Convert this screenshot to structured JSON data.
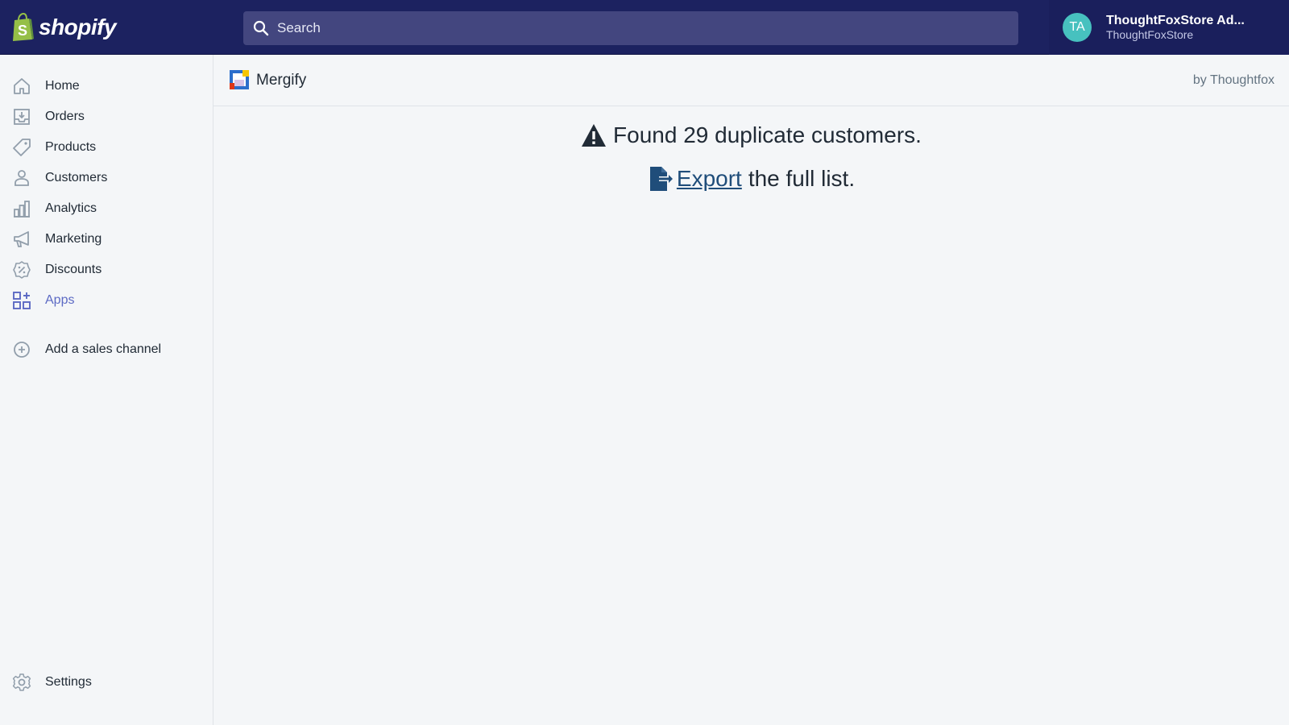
{
  "topbar": {
    "logo_text": "shopify",
    "search_placeholder": "Search",
    "user": {
      "initials": "TA",
      "name": "ThoughtFoxStore Ad...",
      "store": "ThoughtFoxStore"
    }
  },
  "sidebar": {
    "items": [
      {
        "label": "Home",
        "icon": "home-icon"
      },
      {
        "label": "Orders",
        "icon": "orders-icon"
      },
      {
        "label": "Products",
        "icon": "tag-icon"
      },
      {
        "label": "Customers",
        "icon": "person-icon"
      },
      {
        "label": "Analytics",
        "icon": "bar-chart-icon"
      },
      {
        "label": "Marketing",
        "icon": "megaphone-icon"
      },
      {
        "label": "Discounts",
        "icon": "discount-icon"
      },
      {
        "label": "Apps",
        "icon": "apps-icon",
        "active": true
      }
    ],
    "add_channel_label": "Add a sales channel",
    "settings_label": "Settings"
  },
  "app": {
    "name": "Mergify",
    "by": "by Thoughtfox"
  },
  "content": {
    "found_text": "Found 29 duplicate customers.",
    "export_link": "Export",
    "export_rest": "the full list."
  },
  "colors": {
    "topbar_bg": "#1c2260",
    "search_bg": "#43467f",
    "avatar_bg": "#47c1bf",
    "active_nav": "#5c6ac4",
    "export_link": "#1f4d7a"
  }
}
